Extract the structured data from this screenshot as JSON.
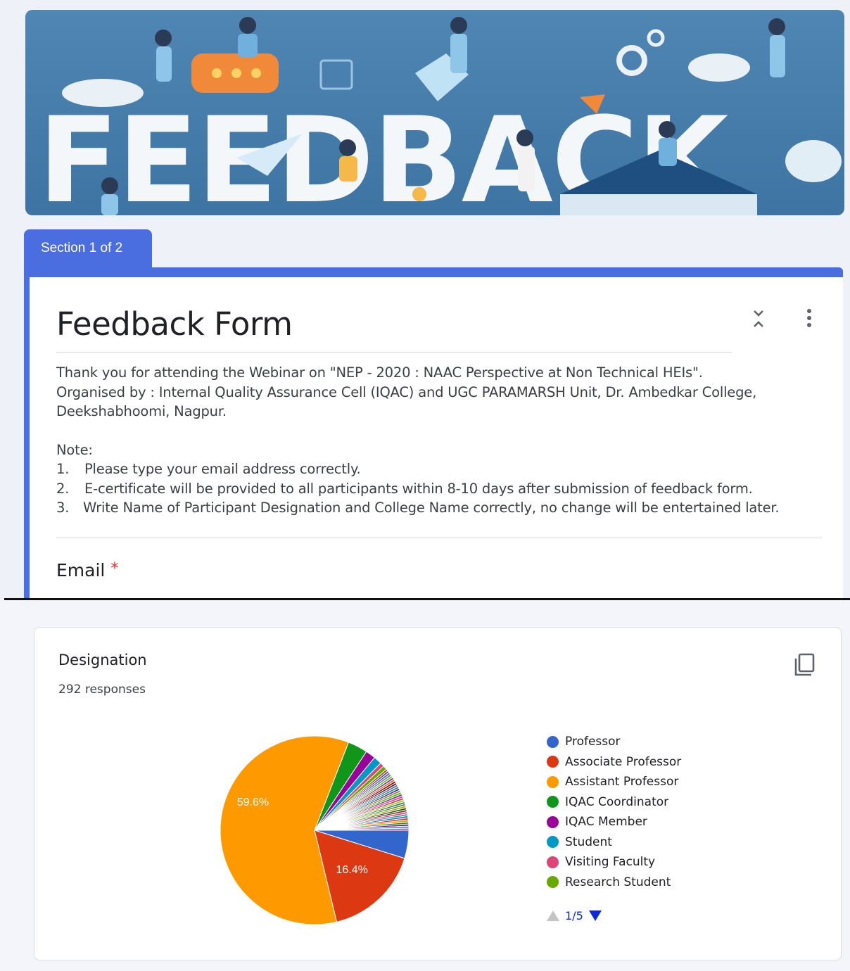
{
  "form_editor": {
    "banner": {
      "word": "FEEDBACK"
    },
    "section_tab": "Section 1 of 2",
    "title": "Feedback Form",
    "description": [
      "Thank you for attending the Webinar on  \"NEP - 2020 : NAAC Perspective at Non Technical HEIs\".",
      "Organised by : Internal Quality Assurance Cell (IQAC) and UGC PARAMARSH Unit, Dr. Ambedkar College, Deekshabhoomi, Nagpur."
    ],
    "note_label": "Note:",
    "notes": [
      {
        "num": "1.",
        "text": "Please type your email address correctly."
      },
      {
        "num": "2.",
        "text": "E-certificate will be provided to all participants within 8-10 days after submission of feedback form."
      },
      {
        "num": "3.",
        "text": "Write Name of Participant Designation and College Name correctly, no change will be entertained later."
      }
    ],
    "first_question": {
      "label": "Email",
      "required_marker": "*"
    },
    "accent_color": "#4a6ee0"
  },
  "response_summary": {
    "question": "Designation",
    "response_count": "292 responses",
    "legend_page": "1/5",
    "icons": [
      "copy-icon",
      "collapse-icon",
      "more-vert-icon",
      "arrow-up-icon",
      "arrow-down-icon"
    ]
  },
  "chart_data": {
    "type": "pie",
    "title": "Designation",
    "legend_position": "right",
    "slices": [
      {
        "label": "Professor",
        "value": 4.8,
        "color": "#3366cc"
      },
      {
        "label": "Associate Professor",
        "value": 16.4,
        "color": "#dc3912",
        "data_label": "16.4%"
      },
      {
        "label": "Assistant Professor",
        "value": 59.6,
        "color": "#ff9900",
        "data_label": "59.6%"
      },
      {
        "label": "IQAC Coordinator",
        "value": 3.4,
        "color": "#109618"
      },
      {
        "label": "IQAC Member",
        "value": 1.7,
        "color": "#990099"
      },
      {
        "label": "Student",
        "value": 1.4,
        "color": "#0099c6"
      },
      {
        "label": "Visiting Faculty",
        "value": 0.7,
        "color": "#dd4477"
      },
      {
        "label": "Research Student",
        "value": 0.7,
        "color": "#66aa00"
      },
      {
        "label": "",
        "value": 0.35,
        "color": "#b82e2e"
      },
      {
        "label": "",
        "value": 0.35,
        "color": "#316395"
      },
      {
        "label": "",
        "value": 0.35,
        "color": "#994499"
      },
      {
        "label": "",
        "value": 0.35,
        "color": "#22aa99"
      },
      {
        "label": "",
        "value": 0.35,
        "color": "#aaaa11"
      },
      {
        "label": "",
        "value": 0.35,
        "color": "#6633cc"
      },
      {
        "label": "",
        "value": 0.35,
        "color": "#e67300"
      },
      {
        "label": "",
        "value": 0.35,
        "color": "#8b0707"
      },
      {
        "label": "",
        "value": 0.35,
        "color": "#651067"
      },
      {
        "label": "",
        "value": 0.35,
        "color": "#329262"
      },
      {
        "label": "",
        "value": 0.35,
        "color": "#5574a6"
      },
      {
        "label": "",
        "value": 0.35,
        "color": "#3b3eac"
      },
      {
        "label": "",
        "value": 0.35,
        "color": "#b77322"
      },
      {
        "label": "",
        "value": 0.35,
        "color": "#16d620"
      },
      {
        "label": "",
        "value": 0.35,
        "color": "#b91383"
      },
      {
        "label": "",
        "value": 0.35,
        "color": "#f4359e"
      },
      {
        "label": "",
        "value": 0.35,
        "color": "#9c5935"
      },
      {
        "label": "",
        "value": 0.35,
        "color": "#a9c413"
      },
      {
        "label": "",
        "value": 0.35,
        "color": "#2a778d"
      },
      {
        "label": "",
        "value": 0.35,
        "color": "#668d1c"
      },
      {
        "label": "",
        "value": 0.35,
        "color": "#bea413"
      },
      {
        "label": "",
        "value": 0.35,
        "color": "#0c5922"
      },
      {
        "label": "",
        "value": 0.35,
        "color": "#743411"
      },
      {
        "label": "",
        "value": 0.35,
        "color": "#ff3399"
      },
      {
        "label": "",
        "value": 0.35,
        "color": "#22aa99"
      },
      {
        "label": "",
        "value": 0.35,
        "color": "#3366cc"
      },
      {
        "label": "",
        "value": 0.35,
        "color": "#dc3912"
      },
      {
        "label": "",
        "value": 0.35,
        "color": "#ff9900"
      },
      {
        "label": "",
        "value": 0.35,
        "color": "#109618"
      },
      {
        "label": "",
        "value": 0.35,
        "color": "#990099"
      },
      {
        "label": "",
        "value": 0.35,
        "color": "#0099c6"
      },
      {
        "label": "",
        "value": 0.35,
        "color": "#dd4477"
      }
    ]
  }
}
